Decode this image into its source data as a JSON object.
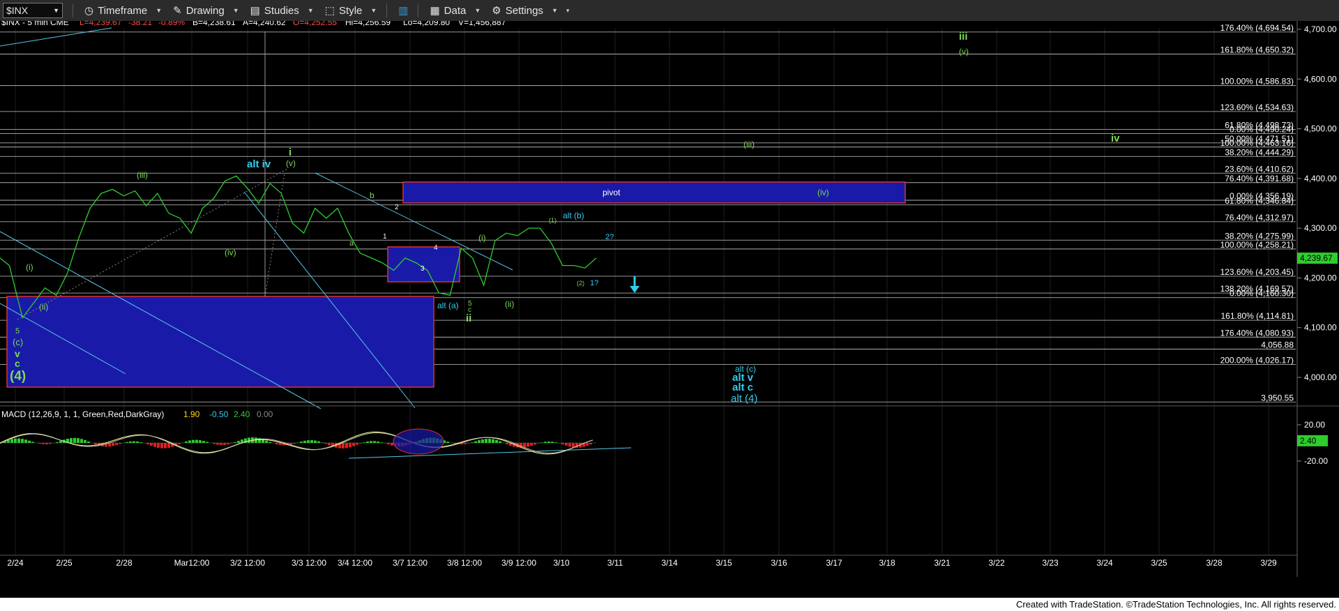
{
  "toolbar": {
    "symbol": "$INX",
    "timeframe": "Timeframe",
    "drawing": "Drawing",
    "studies": "Studies",
    "style": "Style",
    "data": "Data",
    "settings": "Settings"
  },
  "info": {
    "label": "$INX - 5 min  CME",
    "last": "L=4,239.67",
    "chg": "-38.21",
    "pct": "-0.89%",
    "bid": "B=4,238.61",
    "ask": "A=4,240.62",
    "open": "O=4,252.55",
    "hi": "Hi=4,256.59",
    "lo": "Lo=4,209.80",
    "vol": "V=1,456,887"
  },
  "colors": {
    "price": "#2ecc2e",
    "fib_text": "#ffffff",
    "wave_green": "#7ed957",
    "wave_cyan": "#33ccee",
    "box": "#1a1aa8",
    "axis_text": "#ffffff"
  },
  "chart_data": {
    "type": "line",
    "price_axis": {
      "range": [
        3920,
        4720
      ],
      "ticks": [
        "4,700.00",
        "4,600.00",
        "4,500.00",
        "4,400.00",
        "4,300.00",
        "4,200.00",
        "4,100.00",
        "4,000.00"
      ],
      "tick_values": [
        4700,
        4600,
        4500,
        4400,
        4300,
        4200,
        4100,
        4000
      ],
      "last_price": "4,239.67",
      "last_value": 4239.67
    },
    "x_axis": {
      "labels": [
        "2/24",
        "2/25",
        "2/28",
        "Mar12:00",
        "3/2 12:00",
        "3/3 12:00",
        "3/4 12:00",
        "3/7 12:00",
        "3/8 12:00",
        "3/9 12:00",
        "3/10",
        "3/11",
        "3/14",
        "3/15",
        "3/16",
        "3/17",
        "3/18",
        "3/21",
        "3/22",
        "3/23",
        "3/24",
        "3/25",
        "3/28",
        "3/29"
      ]
    },
    "price_path": [
      [
        0,
        4240
      ],
      [
        5,
        4225
      ],
      [
        12,
        4120
      ],
      [
        18,
        4150
      ],
      [
        24,
        4180
      ],
      [
        30,
        4165
      ],
      [
        36,
        4210
      ],
      [
        42,
        4280
      ],
      [
        48,
        4340
      ],
      [
        54,
        4370
      ],
      [
        60,
        4378
      ],
      [
        66,
        4365
      ],
      [
        72,
        4375
      ],
      [
        78,
        4345
      ],
      [
        84,
        4370
      ],
      [
        90,
        4330
      ],
      [
        96,
        4320
      ],
      [
        102,
        4290
      ],
      [
        108,
        4340
      ],
      [
        114,
        4360
      ],
      [
        120,
        4395
      ],
      [
        126,
        4405
      ],
      [
        132,
        4380
      ],
      [
        138,
        4350
      ],
      [
        144,
        4390
      ],
      [
        150,
        4370
      ],
      [
        156,
        4310
      ],
      [
        162,
        4290
      ],
      [
        168,
        4340
      ],
      [
        174,
        4320
      ],
      [
        180,
        4340
      ],
      [
        186,
        4290
      ],
      [
        192,
        4250
      ],
      [
        198,
        4240
      ],
      [
        204,
        4230
      ],
      [
        210,
        4215
      ],
      [
        216,
        4240
      ],
      [
        222,
        4230
      ],
      [
        228,
        4215
      ],
      [
        234,
        4170
      ],
      [
        240,
        4165
      ],
      [
        246,
        4260
      ],
      [
        252,
        4240
      ],
      [
        258,
        4185
      ],
      [
        264,
        4275
      ],
      [
        270,
        4290
      ],
      [
        276,
        4285
      ],
      [
        282,
        4300
      ],
      [
        288,
        4300
      ],
      [
        294,
        4270
      ],
      [
        300,
        4225
      ],
      [
        306,
        4225
      ],
      [
        312,
        4220
      ],
      [
        318,
        4240
      ]
    ],
    "fib_levels": [
      {
        "label": "176.40% (4,694.54)",
        "value": 4694.54
      },
      {
        "label": "161.80% (4,650.32)",
        "value": 4650.32
      },
      {
        "label": "100.00% (4,586.83)",
        "value": 4586.83
      },
      {
        "label": "123.60% (4,534.63)",
        "value": 4534.63
      },
      {
        "label": "61.80% (4,498.73)",
        "value": 4498.73
      },
      {
        "label": "0.00% (4,490.24)",
        "value": 4490.24
      },
      {
        "label": "50.00% (4,471.51)",
        "value": 4471.51
      },
      {
        "label": "100.00% (4,463.16)",
        "value": 4463.16
      },
      {
        "label": "38.20% (4,444.29)",
        "value": 4444.29
      },
      {
        "label": "23.60% (4,410.62)",
        "value": 4410.62
      },
      {
        "label": "76.40% (4,391.68)",
        "value": 4391.68
      },
      {
        "label": "0.00% (4,356.19)",
        "value": 4356.19
      },
      {
        "label": "61.80% (4,346.84)",
        "value": 4346.84
      },
      {
        "label": "76.40% (4,312.97)",
        "value": 4312.97
      },
      {
        "label": "38.20% (4,275.99)",
        "value": 4275.99
      },
      {
        "label": "100.00% (4,258.21)",
        "value": 4258.21
      },
      {
        "label": "123.60% (4,203.45)",
        "value": 4203.45
      },
      {
        "label": "138.20% (4,169.57)",
        "value": 4169.57
      },
      {
        "label": "0.00% (4,160.30)",
        "value": 4160.3
      },
      {
        "label": "161.80% (4,114.81)",
        "value": 4114.81
      },
      {
        "label": "176.40% (4,080.93)",
        "value": 4080.93
      },
      {
        "label": "4,056.88",
        "value": 4056.88
      },
      {
        "label": "200.00% (4,026.17)",
        "value": 4026.17
      },
      {
        "label": "3,950.55",
        "value": 3950.55
      }
    ],
    "annotations": {
      "pivot": "pivot",
      "alt_iv": "alt iv",
      "i": "i",
      "v_paren": "(v)",
      "iii_paren": "(iii)",
      "iv_paren": "(iv)",
      "i_paren": "(i)",
      "ii_paren": "(ii)",
      "five": "5",
      "c_paren": "(c)",
      "v": "v",
      "c": "c",
      "four_paren": "(4)",
      "a": "a",
      "b": "b",
      "one": "1",
      "two": "2",
      "three": "3",
      "four": "4",
      "alt_a": "alt (a)",
      "ii": "ii",
      "alt_b": "alt (b)",
      "one_paren": "(1)",
      "two_paren": "(2)",
      "one_q": "1?",
      "two_q": "2?",
      "iii_top": "iii",
      "v_top": "(v)",
      "iii_mid": "(iii)",
      "iv_right": "iv",
      "iv_pivot": "(iv)",
      "alt_c_paren": "alt (c)",
      "alt_v": "alt v",
      "alt_c": "alt c",
      "alt_4": "alt (4)"
    },
    "macd": {
      "label": "MACD (12,26,9, 1, 1, Green,Red,DarkGray)",
      "val1": "1.90",
      "val2": "-0.50",
      "val3": "2.40",
      "val4": "0.00",
      "ticks": [
        "20.00",
        "-20.00"
      ],
      "tick_values": [
        20,
        -20
      ],
      "current": "2.40",
      "current_value": 2.4
    }
  },
  "footer": "Created with TradeStation. ©TradeStation Technologies, Inc. All rights reserved."
}
